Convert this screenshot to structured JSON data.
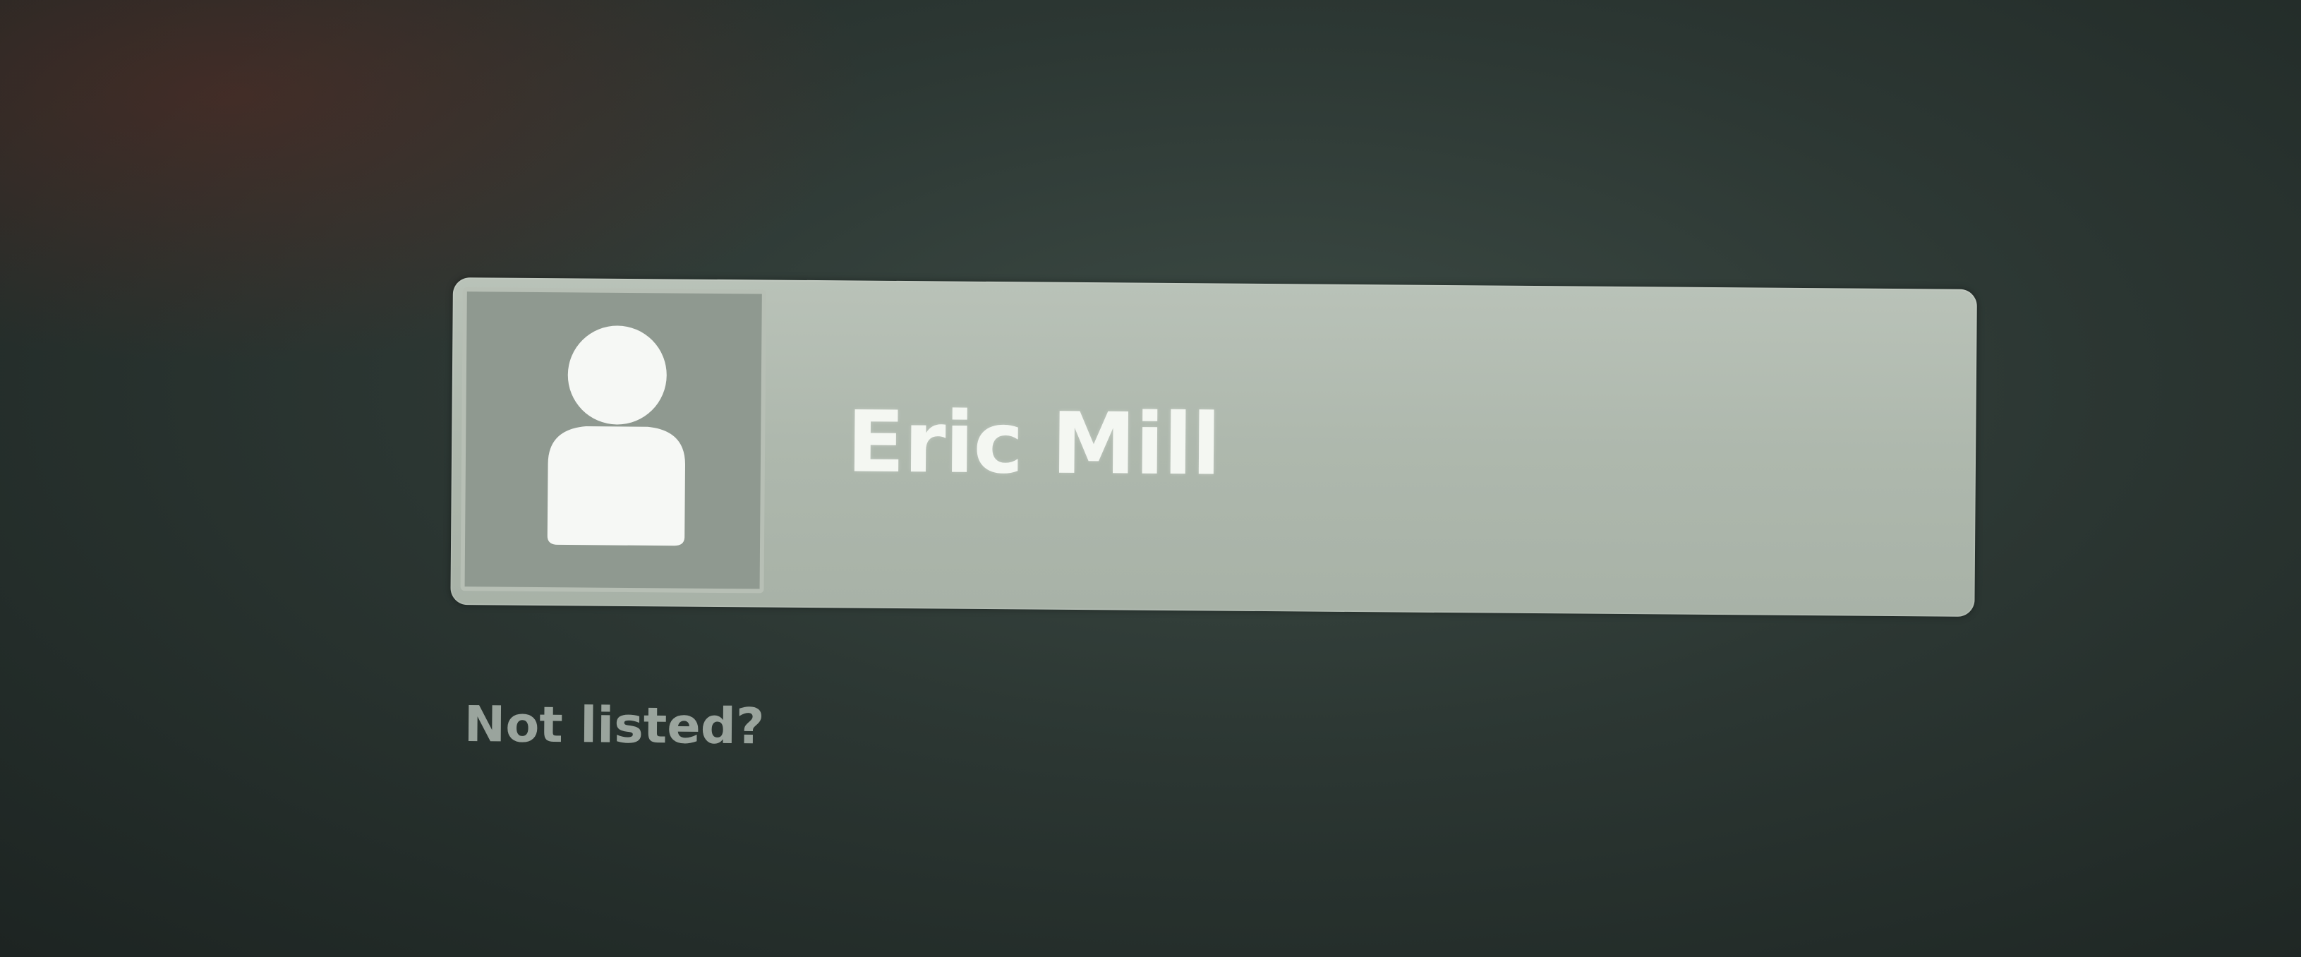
{
  "user_list": {
    "users": [
      {
        "name": "Eric Mill",
        "avatar_icon": "user-silhouette-icon"
      }
    ],
    "not_listed_label": "Not listed?"
  },
  "colors": {
    "background": "#2c3733",
    "user_row": "#aeb8ad",
    "user_name_text": "#f4f7f2",
    "not_listed_text": "#9aa49d"
  }
}
